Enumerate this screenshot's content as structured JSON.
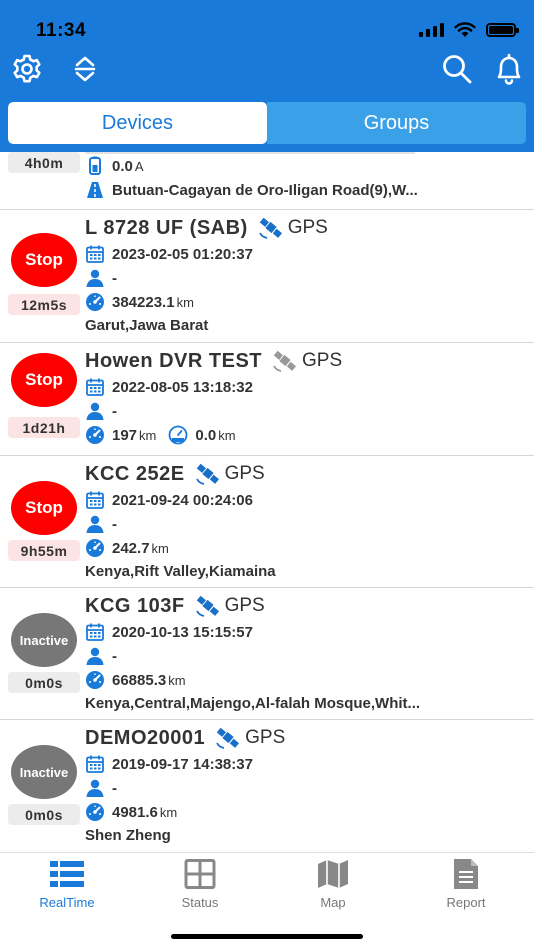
{
  "status_bar": {
    "time": "11:34"
  },
  "colors": {
    "accent": "#1a7ad9",
    "stop": "#ff0000",
    "inactive": "#777777"
  },
  "toolbar": {
    "icons": [
      "gear-icon",
      "sort-icon",
      "search-icon",
      "bell-icon"
    ]
  },
  "tabs": [
    {
      "label": "Devices",
      "active": true
    },
    {
      "label": "Groups",
      "active": false
    }
  ],
  "partial_device": {
    "duration": "4h0m",
    "power": "0.0",
    "power_unit": "A",
    "address": "Butuan-Cagayan de Oro-Iligan Road(9),W..."
  },
  "devices": [
    {
      "name": "L 8728 UF (SAB)",
      "gps": "GPS",
      "status": "Stop",
      "duration": "12m5s",
      "time": "2023-02-05 01:20:37",
      "driver": "-",
      "mileage": "384223.1",
      "mileage_unit": "km",
      "address": "Garut,Jawa Barat"
    },
    {
      "name": "Howen DVR TEST",
      "gps": "GPS",
      "status": "Stop",
      "duration": "1d21h",
      "time": "2022-08-05 13:18:32",
      "driver": "-",
      "mileage": "197",
      "mileage_unit": "km",
      "speed": "0.0",
      "speed_unit": "km",
      "address": ""
    },
    {
      "name": "KCC 252E",
      "gps": "GPS",
      "status": "Stop",
      "duration": "9h55m",
      "time": "2021-09-24 00:24:06",
      "driver": "-",
      "mileage": "242.7",
      "mileage_unit": "km",
      "address": "Kenya,Rift Valley,Kiamaina"
    },
    {
      "name": "KCG 103F",
      "gps": "GPS",
      "status": "Inactive",
      "duration": "0m0s",
      "time": "2020-10-13 15:15:57",
      "driver": "-",
      "mileage": "66885.3",
      "mileage_unit": "km",
      "address": "Kenya,Central,Majengo,Al-falah Mosque,Whit..."
    },
    {
      "name": "DEMO20001",
      "gps": "GPS",
      "status": "Inactive",
      "duration": "0m0s",
      "time": "2019-09-17 14:38:37",
      "driver": "-",
      "mileage": "4981.6",
      "mileage_unit": "km",
      "address": "Shen Zheng"
    }
  ],
  "bottom_nav": [
    {
      "label": "RealTime",
      "icon": "list-icon",
      "active": true
    },
    {
      "label": "Status",
      "icon": "grid-icon",
      "active": false
    },
    {
      "label": "Map",
      "icon": "map-icon",
      "active": false
    },
    {
      "label": "Report",
      "icon": "report-icon",
      "active": false
    }
  ]
}
